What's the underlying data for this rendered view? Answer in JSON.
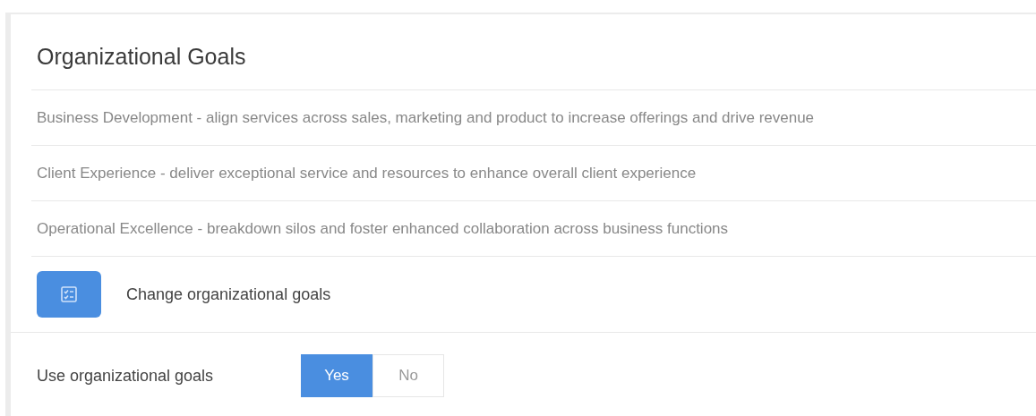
{
  "panel": {
    "title": "Organizational Goals",
    "goals": [
      "Business Development - align services across sales, marketing and product to increase offerings and drive revenue",
      "Client Experience - deliver exceptional service and resources to enhance overall client experience",
      "Operational Excellence - breakdown silos and foster enhanced collaboration across business functions"
    ],
    "change_action": {
      "label": "Change organizational goals"
    },
    "setting": {
      "label": "Use organizational goals",
      "options": [
        {
          "label": "Yes",
          "selected": true
        },
        {
          "label": "No",
          "selected": false
        }
      ]
    }
  }
}
